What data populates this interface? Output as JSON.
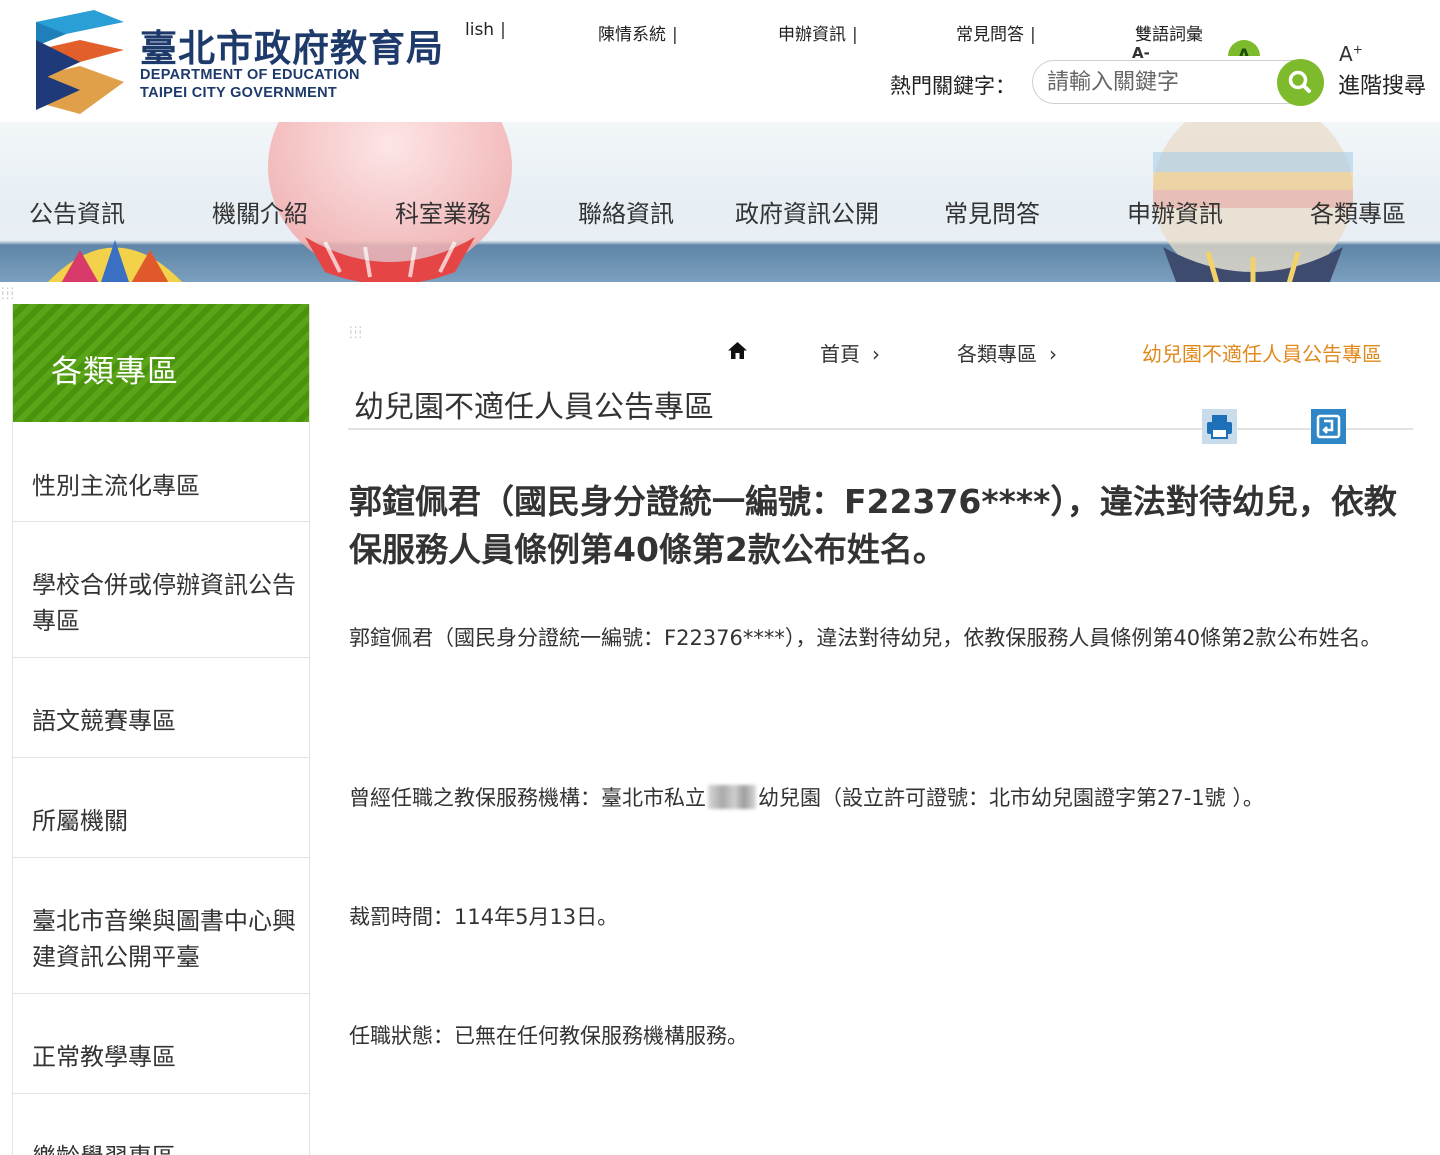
{
  "header": {
    "title_zh": "臺北市政府教育局",
    "title_en_line1": "DEPARTMENT OF  EDUCATION",
    "title_en_line2": "TAIPEI CITY GOVERNMENT",
    "top_links": [
      "lish",
      "陳情系統",
      "申辦資訊",
      "常見問答",
      "雙語詞彙"
    ],
    "font_size_minus": "A-",
    "font_size_normal": "A",
    "font_size_plus": "A",
    "keyword_label": "熱門關鍵字：",
    "search_placeholder": "請輸入關鍵字",
    "advanced_search": "進階搜尋"
  },
  "nav": [
    "公告資訊",
    "機關介紹",
    "科室業務",
    "聯絡資訊",
    "政府資訊公開",
    "常見問答",
    "申辦資訊",
    "各類專區"
  ],
  "sidebar": {
    "title": "各類專區",
    "items": [
      "性別主流化專區",
      "學校合併或停辦資訊公告專區",
      "語文競賽專區",
      "所屬機關",
      "臺北市音樂與圖書中心興建資訊公開平臺",
      "正常教學專區",
      "樂齡學習專區"
    ]
  },
  "breadcrumb": [
    "首頁",
    "各類專區",
    "幼兒園不適任人員公告專區"
  ],
  "page_title": "幼兒園不適任人員公告專區",
  "article": {
    "headline": "郭鍹佩君（國民身分證統一編號：F22376****），違法對待幼兒，依教保服務人員條例第40條第2款公布姓名。",
    "p1": "郭鍹佩君（國民身分證統一編號：F22376****），違法對待幼兒，依教保服務人員條例第40條第2款公布姓名。",
    "p2_before": "曾經任職之教保服務機構：臺北市私立",
    "p2_after": "幼兒園（設立許可證號：北市幼兒園證字第27-1號 ）。",
    "p3": "裁罰時間：114年5月13日。",
    "p4": "任職狀態：已無在任何教保服務機構服務。"
  },
  "colors": {
    "brand_blue": "#1d3a6b",
    "accent_green": "#7dbb2c",
    "sidebar_green": "#4f9a10",
    "breadcrumb_current": "#e08a1e"
  },
  "icons": {
    "search": "magnifier-icon",
    "home": "home-icon",
    "print": "printer-icon",
    "back": "back-arrow-icon"
  }
}
